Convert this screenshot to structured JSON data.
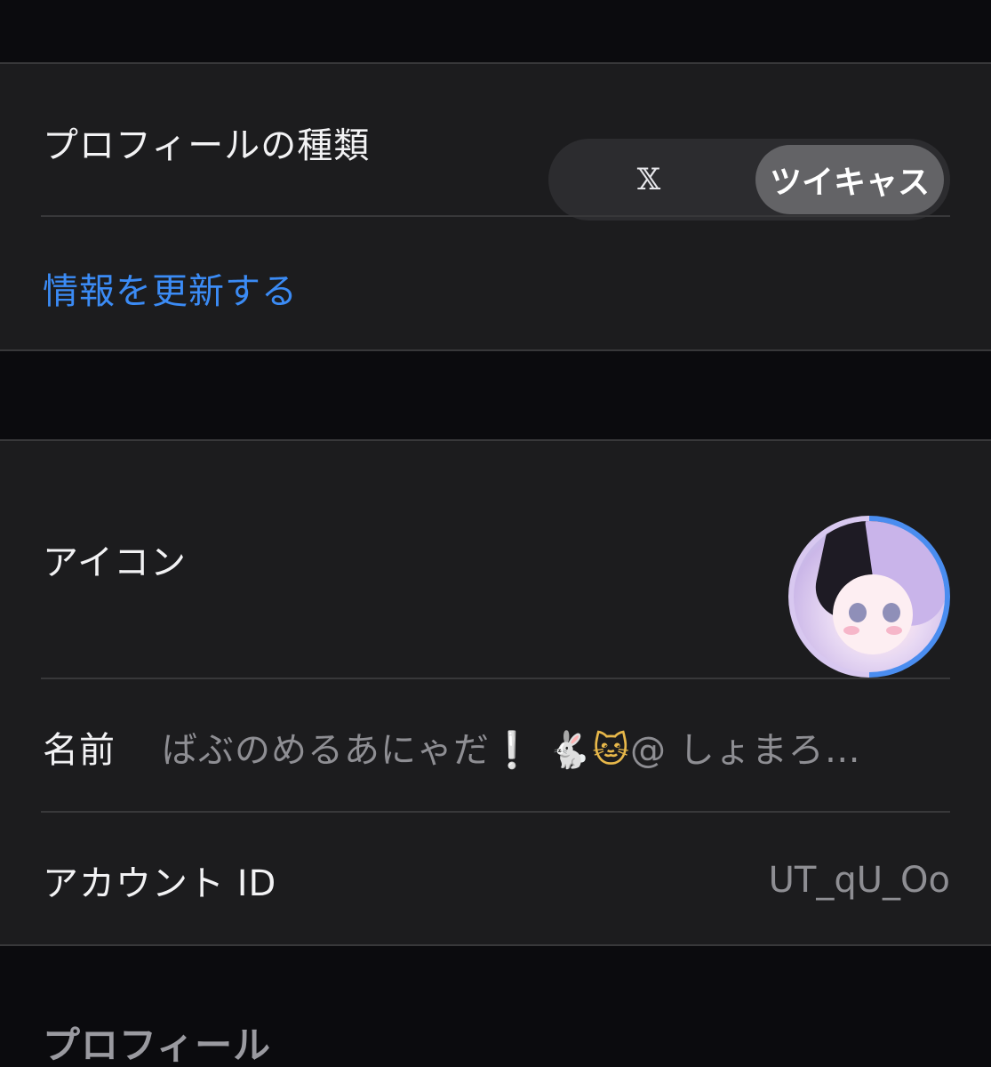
{
  "profile_settings": {
    "type_label": "プロフィールの種類",
    "segments": [
      {
        "label": "𝕏",
        "selected": false
      },
      {
        "label": "ツイキャス",
        "selected": true
      }
    ],
    "update_link": "情報を更新する"
  },
  "account": {
    "icon_label": "アイコン",
    "name_label": "名前",
    "name_value_text": "ばぶのめるあにゃだ",
    "name_value_exclaim": "❕",
    "name_value_rabbit": "🐇",
    "name_value_cat": "🐱",
    "name_value_tail": "@ しょまろ…",
    "account_id_label": "アカウント ID",
    "account_id_value": "UT_qU_Oo"
  },
  "profile_section_header": "プロフィール",
  "colors": {
    "background": "#0b0b0e",
    "group_background": "#1c1c1e",
    "link": "#3b8bf5",
    "secondary_text": "#8e8e93",
    "selected_segment": "#636366"
  }
}
